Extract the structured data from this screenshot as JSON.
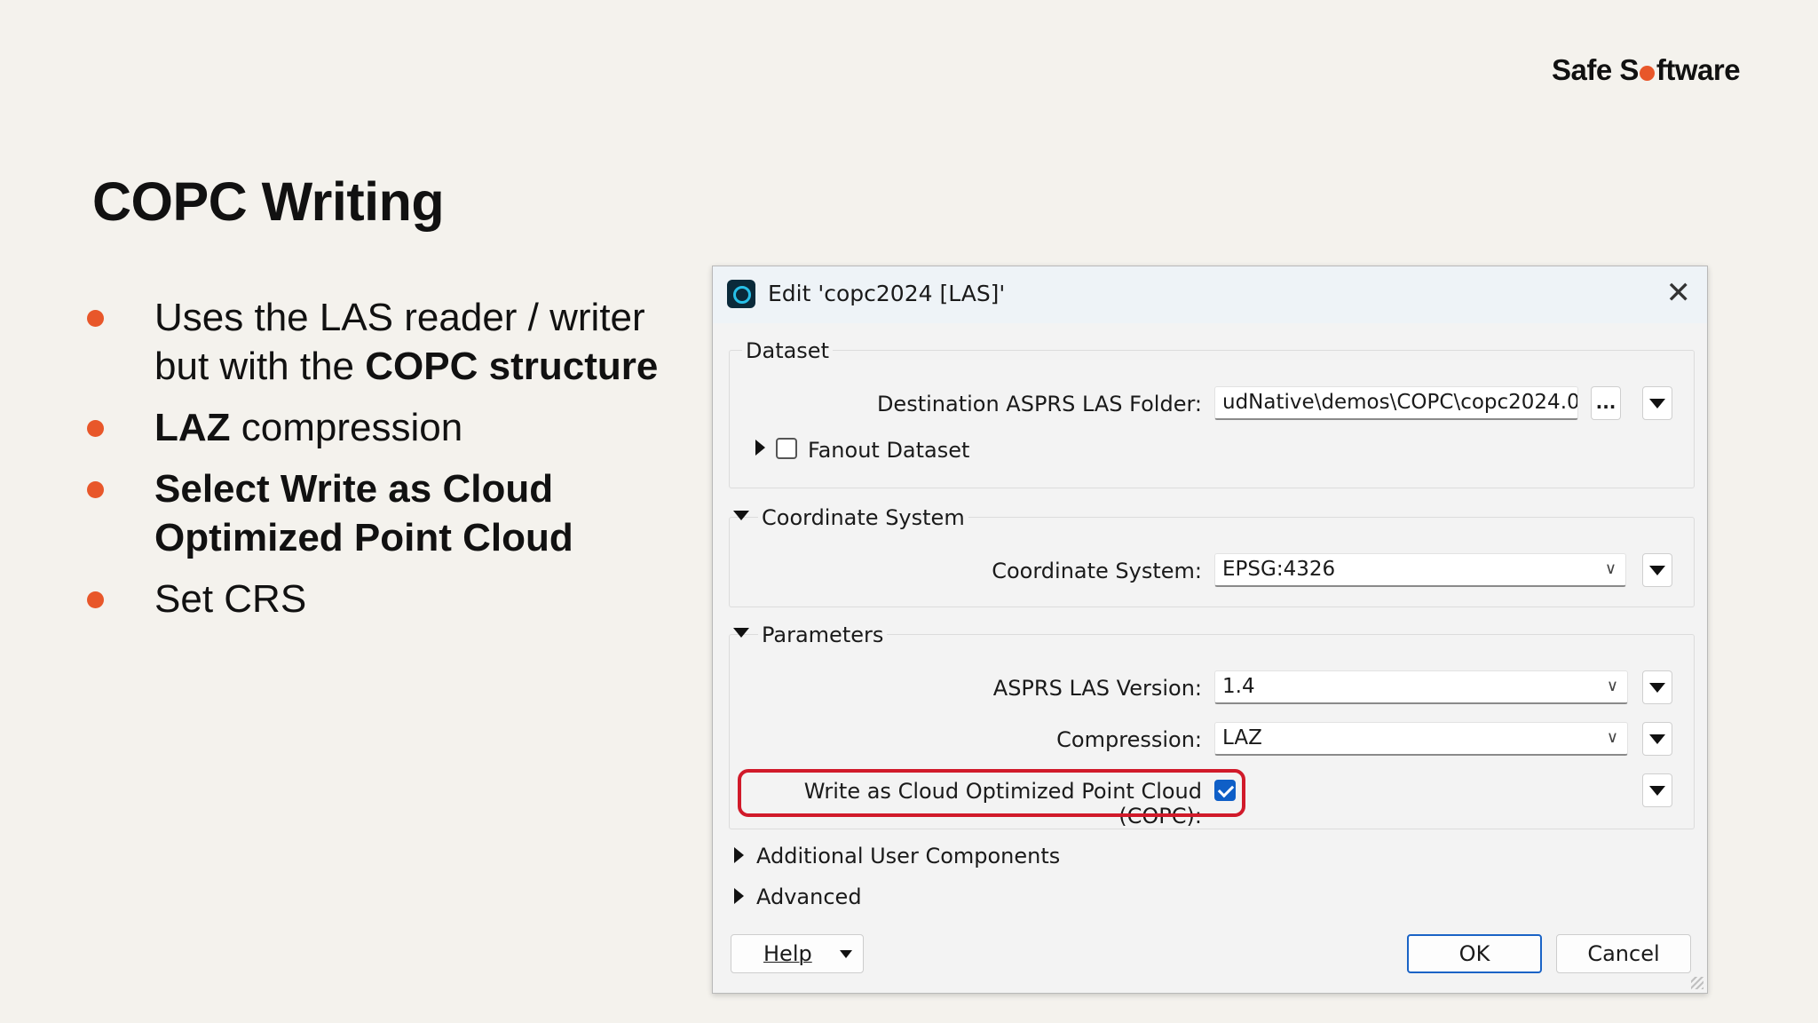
{
  "logo": {
    "pre": "Safe S",
    "post": "ftware"
  },
  "slide": {
    "title": "COPC Writing",
    "bullets": [
      {
        "normal_a": "Uses the LAS reader / writer",
        "normal_b": "but with the ",
        "bold": "COPC structure"
      },
      {
        "bold": "LAZ",
        "normal": " compression"
      },
      {
        "bold_a": "Select Write as Cloud",
        "bold_b": "Optimized Point Cloud"
      },
      {
        "normal": "Set CRS"
      }
    ]
  },
  "dialog": {
    "title": "Edit 'copc2024 [LAS]'",
    "close_icon": "close-icon",
    "dataset": {
      "group_label": "Dataset",
      "dest_label": "Destination ASPRS LAS Folder:",
      "dest_value": "udNative\\demos\\COPC\\copc2024.0\"",
      "browse_label": "...",
      "fanout_label": "Fanout Dataset",
      "fanout_checked": false
    },
    "coordinate_system": {
      "group_label": "Coordinate System",
      "label": "Coordinate System:",
      "value": "EPSG:4326"
    },
    "parameters": {
      "group_label": "Parameters",
      "version_label": "ASPRS LAS Version:",
      "version_value": "1.4",
      "compression_label": "Compression:",
      "compression_value": "LAZ",
      "copc_label": "Write as Cloud Optimized Point Cloud (COPC):",
      "copc_checked": true
    },
    "additional_label": "Additional User Components",
    "advanced_label": "Advanced",
    "help_label": "Help",
    "ok_label": "OK",
    "cancel_label": "Cancel"
  },
  "colors": {
    "accent_orange": "#e8572a",
    "highlight_red": "#d11a2a",
    "checkbox_blue": "#0f5fc7",
    "background": "#f4f2ed"
  }
}
